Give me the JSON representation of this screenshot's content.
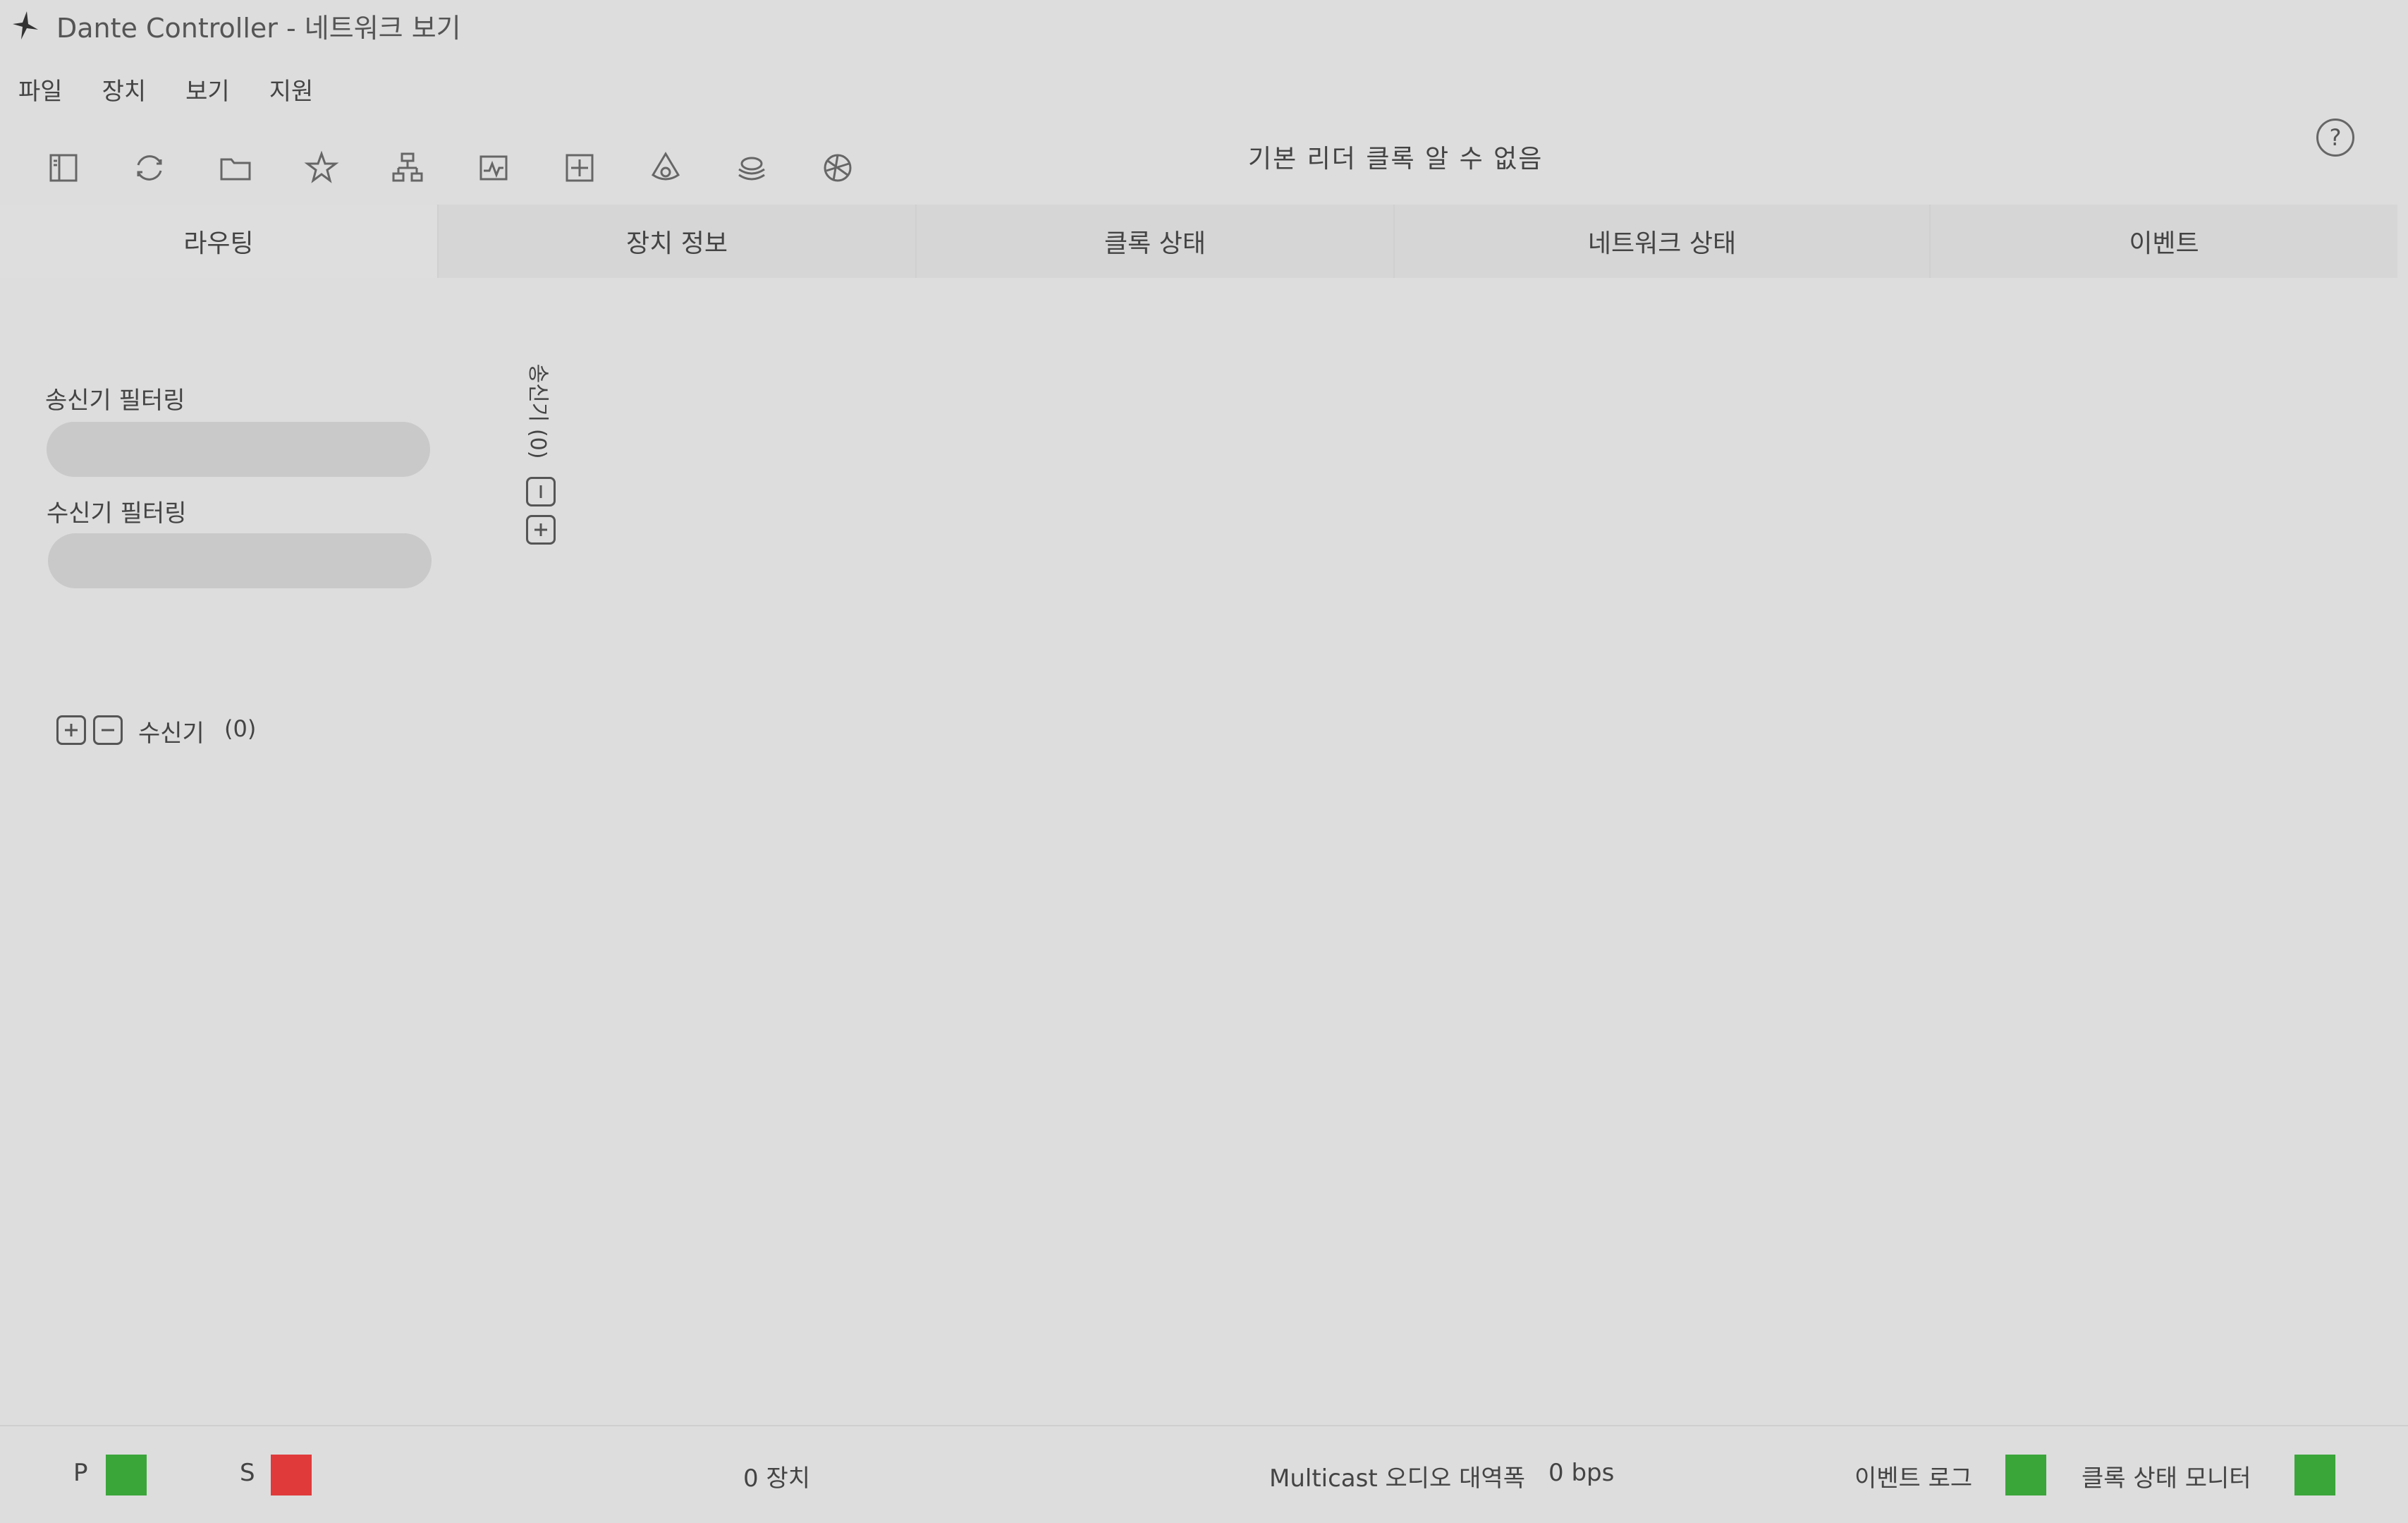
{
  "window": {
    "title": "Dante Controller - 네트워크 보기",
    "logo_icon": "dante-logo-icon"
  },
  "menu": {
    "items": [
      "파일",
      "장치",
      "보기",
      "지원"
    ]
  },
  "toolbar": {
    "icons": [
      "sidebar-toggle-icon",
      "refresh-icon",
      "folder-icon",
      "star-icon",
      "network-hierarchy-icon",
      "monitor-graph-icon",
      "add-box-icon",
      "clock-domain-icon",
      "stack-icon",
      "network-globe-icon"
    ],
    "status_text": "기본 리더 클록 알 수 없음",
    "help_label": "?"
  },
  "tabs": [
    {
      "label": "라우팅",
      "active": true
    },
    {
      "label": "장치 정보",
      "active": false
    },
    {
      "label": "클록 상태",
      "active": false
    },
    {
      "label": "네트워크 상태",
      "active": false
    },
    {
      "label": "이벤트",
      "active": false
    }
  ],
  "routing": {
    "transmitter_filter_label": "송신기 필터링",
    "transmitter_filter_value": "",
    "receiver_filter_label": "수신기 필터링",
    "receiver_filter_value": "",
    "transmitters_label": "송신기 (0)",
    "receivers_label": "수신기",
    "receivers_count": "(0)"
  },
  "statusbar": {
    "primary_label": "P",
    "primary_color": "#3aa63a",
    "secondary_label": "S",
    "secondary_color": "#e03a3a",
    "device_count": "0 장치",
    "multicast_label": "Multicast 오디오 대역폭",
    "multicast_value": "0 bps",
    "event_log_label": "이벤트 로그",
    "event_log_color": "#3aa63a",
    "clock_monitor_label": "클록 상태 모니터",
    "clock_monitor_color": "#3aa63a"
  }
}
